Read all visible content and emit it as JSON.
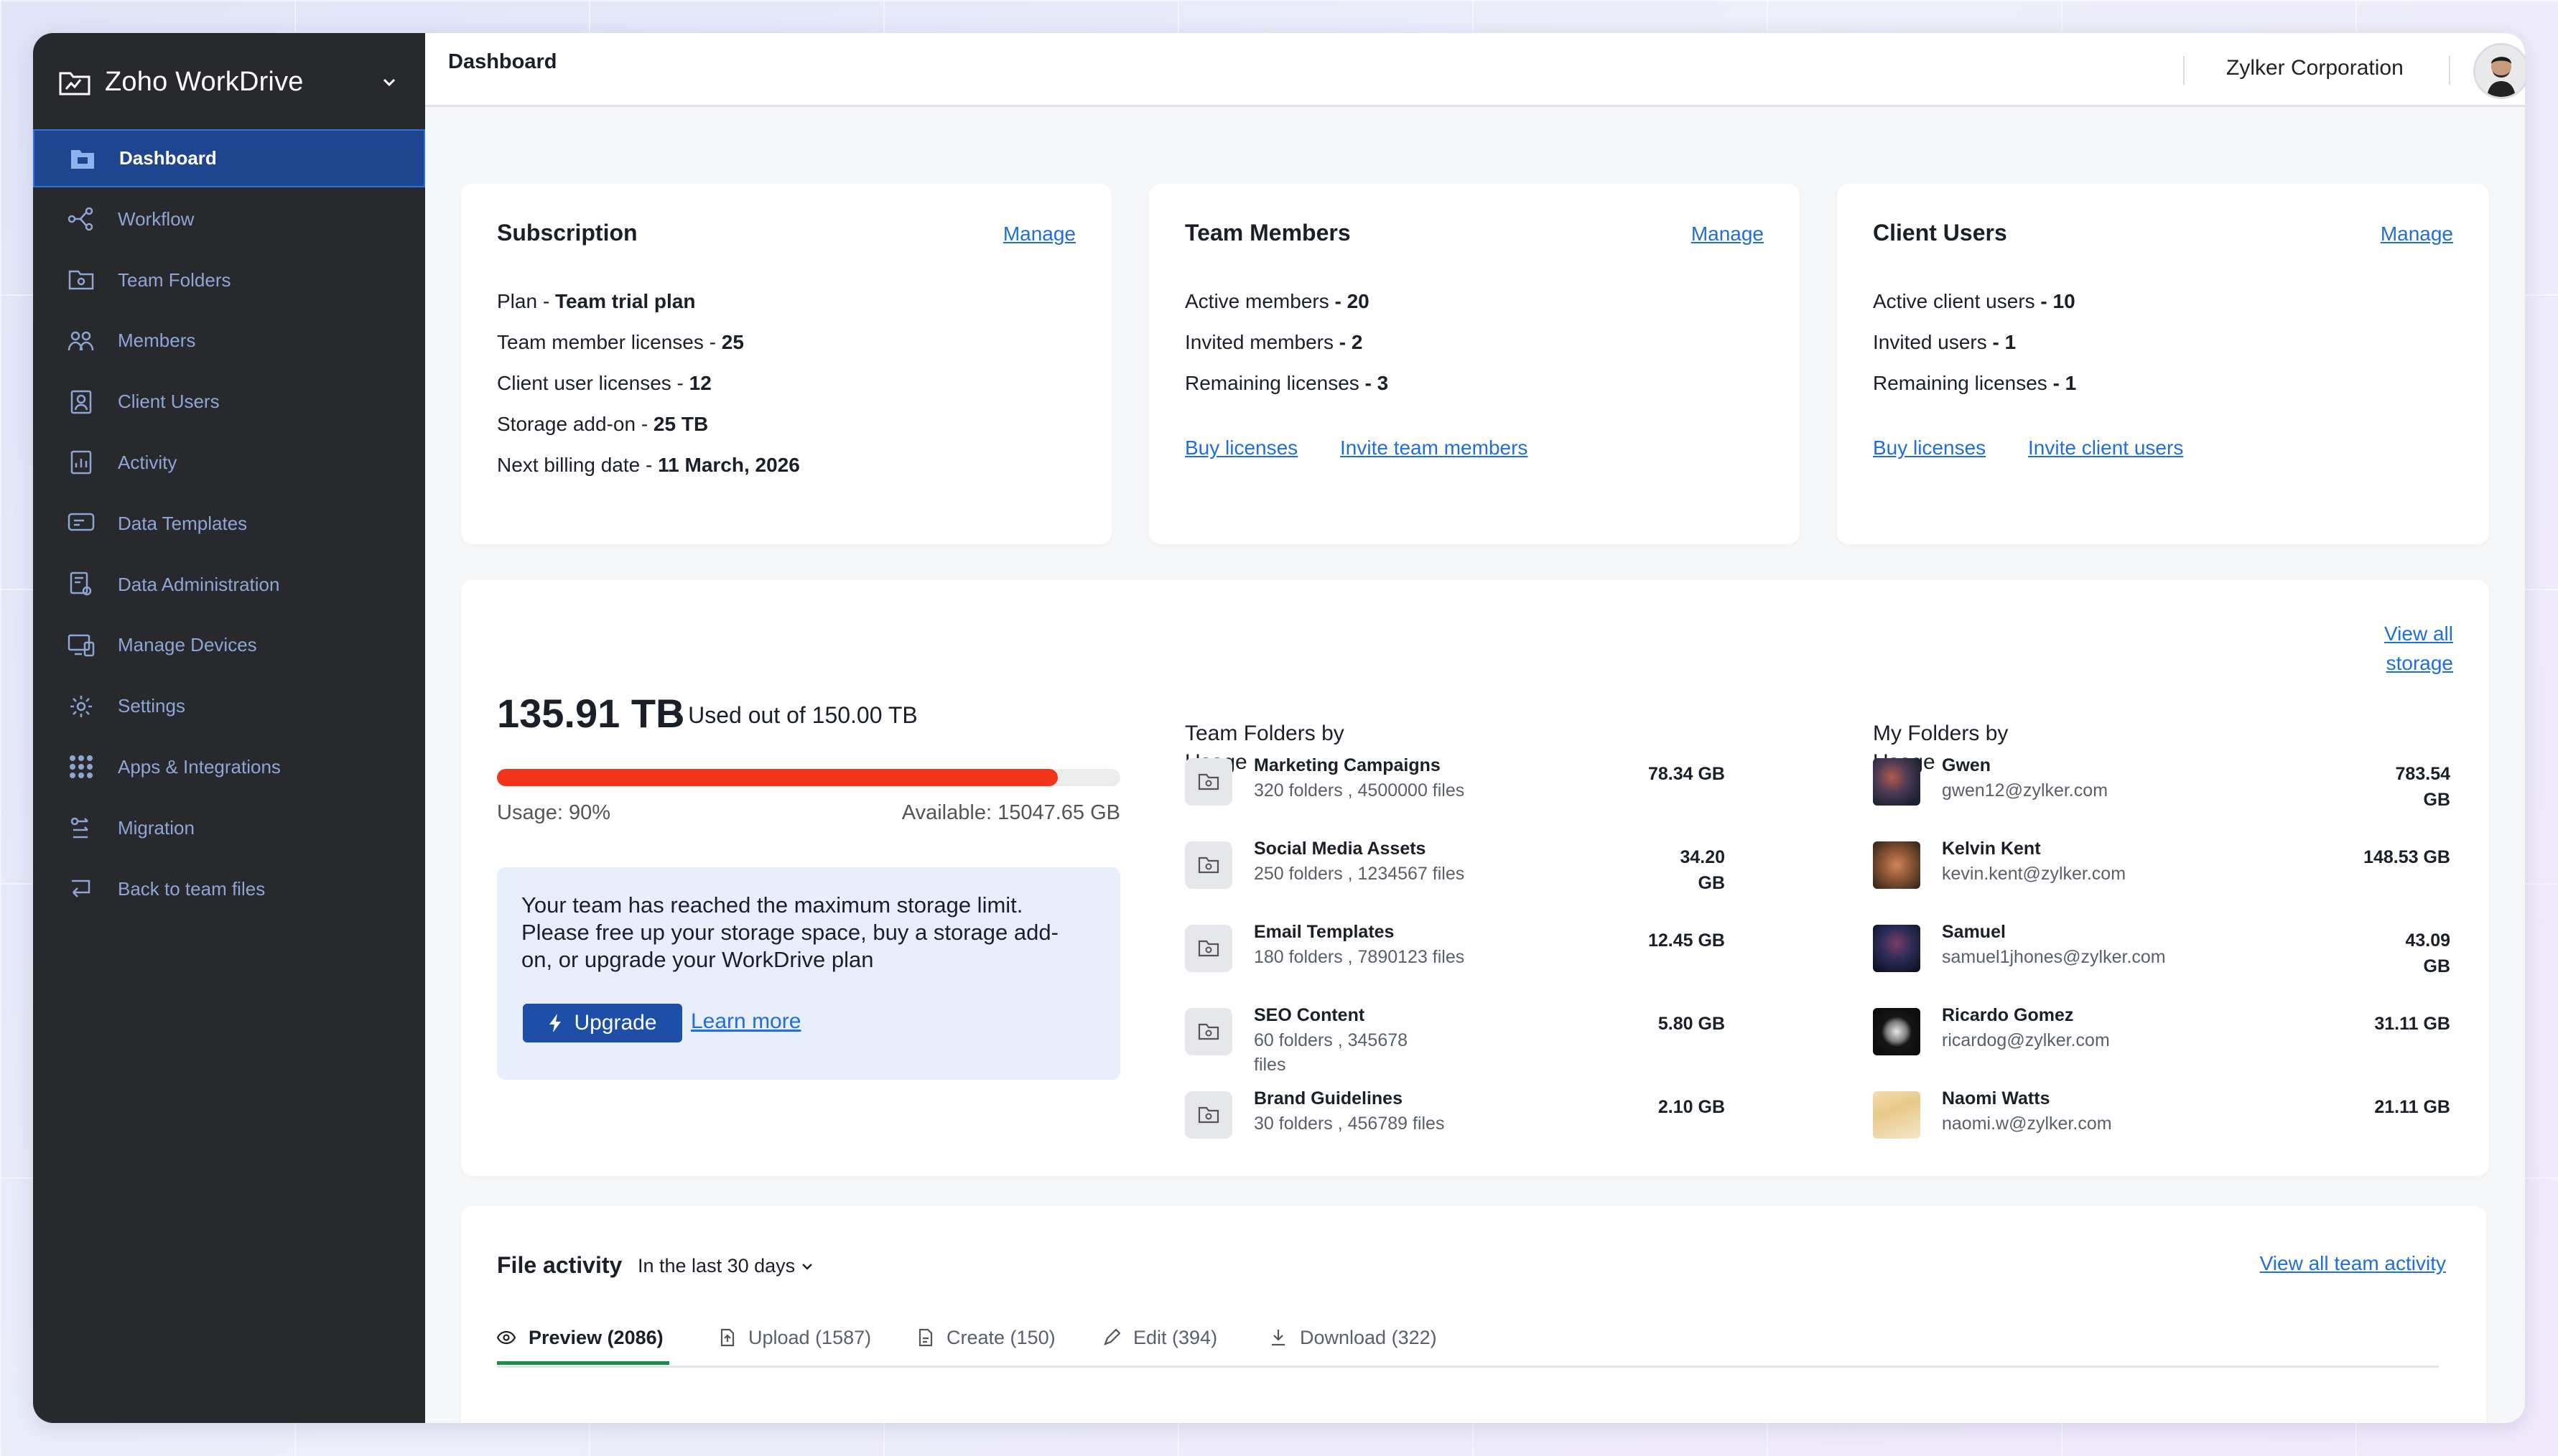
{
  "app": {
    "brand": "Zoho WorkDrive",
    "page_title": "Dashboard",
    "organization": "Zylker Corporation"
  },
  "sidebar": {
    "items": [
      {
        "label": "Dashboard",
        "icon": "dashboard-folder-icon",
        "active": true
      },
      {
        "label": "Workflow",
        "icon": "workflow-icon"
      },
      {
        "label": "Team Folders",
        "icon": "team-folder-icon"
      },
      {
        "label": "Members",
        "icon": "members-icon"
      },
      {
        "label": "Client Users",
        "icon": "client-users-icon"
      },
      {
        "label": "Activity",
        "icon": "activity-icon"
      },
      {
        "label": "Data Templates",
        "icon": "data-templates-icon"
      },
      {
        "label": "Data Administration",
        "icon": "data-administration-icon"
      },
      {
        "label": "Manage Devices",
        "icon": "manage-devices-icon"
      },
      {
        "label": "Settings",
        "icon": "gear-icon"
      },
      {
        "label": "Apps & Integrations",
        "icon": "apps-grid-icon"
      },
      {
        "label": "Migration",
        "icon": "migration-icon"
      },
      {
        "label": "Back to team files",
        "icon": "back-arrow-icon"
      }
    ]
  },
  "subscription": {
    "title": "Subscription",
    "manage": "Manage",
    "lines": [
      {
        "label": "Plan - ",
        "value": "Team trial plan"
      },
      {
        "label": "Team member licenses - ",
        "value": "25"
      },
      {
        "label": "Client user licenses - ",
        "value": "12"
      },
      {
        "label": "Storage add-on - ",
        "value": "25 TB"
      },
      {
        "label": "Next billing date - ",
        "value": "11 March, 2026"
      }
    ]
  },
  "team_members": {
    "title": "Team Members",
    "manage": "Manage",
    "lines": [
      {
        "label": "Active members ",
        "value": "- 20"
      },
      {
        "label": "Invited members ",
        "value": "- 2"
      },
      {
        "label": "Remaining licenses ",
        "value": "- 3"
      }
    ],
    "buy": "Buy licenses",
    "invite": "Invite team members"
  },
  "client_users": {
    "title": "Client Users",
    "manage": "Manage",
    "lines": [
      {
        "label": "Active client users ",
        "value": "- 10"
      },
      {
        "label": "Invited users ",
        "value": "- 1"
      },
      {
        "label": "Remaining licenses ",
        "value": "- 1"
      }
    ],
    "buy": "Buy licenses",
    "invite": "Invite client users"
  },
  "storage": {
    "used": "135.91 TB",
    "used_suffix": "• Used out of 150.00 TB",
    "usage_pct": 90,
    "usage_text": "Usage: 90%",
    "available_text": "Available: 15047.65 GB",
    "alert": "Your team has reached the maximum storage limit. Please free up your storage space, buy a storage add-on, or upgrade your WorkDrive plan",
    "upgrade": "Upgrade",
    "learn_more": "Learn more",
    "view_all_1": "View all",
    "view_all_2": "storage",
    "team_head_1": "Team Folders by",
    "team_head_2": "Usage",
    "team_folders": [
      {
        "name": "Marketing Campaigns",
        "meta1": "320 folders , 4500000 files",
        "meta2": "",
        "size1": "78.34 GB",
        "size2": ""
      },
      {
        "name": "Social Media Assets",
        "meta1": "250 folders , 1234567 files",
        "meta2": "",
        "size1": "34.20",
        "size2": "GB"
      },
      {
        "name": "Email Templates",
        "meta1": "180 folders , 7890123 files",
        "meta2": "",
        "size1": "12.45 GB",
        "size2": ""
      },
      {
        "name": "SEO Content",
        "meta1": "60 folders , 345678",
        "meta2": "files",
        "size1": "5.80 GB",
        "size2": ""
      },
      {
        "name": "Brand Guidelines",
        "meta1": "30 folders , 456789 files",
        "meta2": "",
        "size1": "2.10 GB",
        "size2": ""
      }
    ],
    "my_head_1": "My Folders by",
    "my_head_2": "Usage",
    "my_folders": [
      {
        "name": "Gwen",
        "email": "gwen12@zylker.com",
        "size1": "783.54",
        "size2": "GB"
      },
      {
        "name": "Kelvin Kent",
        "email": "kevin.kent@zylker.com",
        "size1": "148.53 GB",
        "size2": ""
      },
      {
        "name": "Samuel",
        "email": "samuel1jhones@zylker.com",
        "size1": "43.09",
        "size2": "GB"
      },
      {
        "name": "Ricardo Gomez",
        "email": "ricardog@zylker.com",
        "size1": "31.11 GB",
        "size2": ""
      },
      {
        "name": "Naomi Watts",
        "email": "naomi.w@zylker.com",
        "size1": "21.11 GB",
        "size2": ""
      }
    ]
  },
  "file_activity": {
    "title": "File activity",
    "range": "In the last 30 days",
    "view_all": "View all team activity",
    "tabs": [
      {
        "label": "Preview (2086)",
        "icon": "eye-icon",
        "active": true
      },
      {
        "label": "Upload (1587)",
        "icon": "upload-icon"
      },
      {
        "label": "Create (150)",
        "icon": "create-icon"
      },
      {
        "label": "Edit (394)",
        "icon": "pencil-icon"
      },
      {
        "label": "Download (322)",
        "icon": "download-icon"
      }
    ]
  }
}
